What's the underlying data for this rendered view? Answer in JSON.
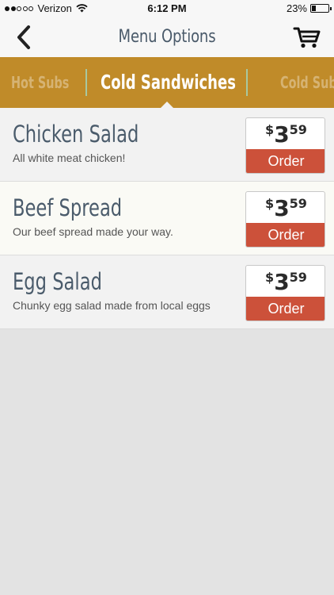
{
  "status_bar": {
    "carrier": "Verizon",
    "time": "6:12 PM",
    "battery_percent": "23%",
    "battery_level": 0.23,
    "signal_full": 2,
    "signal_total": 5
  },
  "nav": {
    "title": "Menu Options",
    "back_icon": "chevron-left-icon",
    "cart_icon": "cart-icon"
  },
  "tabs": {
    "prev": "Hot Subs",
    "active": "Cold Sandwiches",
    "next": "Cold Subs"
  },
  "items": [
    {
      "name": "Chicken Salad",
      "description": "All white meat chicken!",
      "price_dollar": "$",
      "price_whole": "3",
      "price_cents": "59",
      "order_label": "Order"
    },
    {
      "name": "Beef Spread",
      "description": "Our beef spread made your way.",
      "price_dollar": "$",
      "price_whole": "3",
      "price_cents": "59",
      "order_label": "Order"
    },
    {
      "name": "Egg Salad",
      "description": "Chunky egg salad made from local eggs",
      "price_dollar": "$",
      "price_whole": "3",
      "price_cents": "59",
      "order_label": "Order"
    }
  ],
  "colors": {
    "tab_bar": "#c08b29",
    "order_button": "#cc513a",
    "title_text": "#4a5b6b"
  }
}
